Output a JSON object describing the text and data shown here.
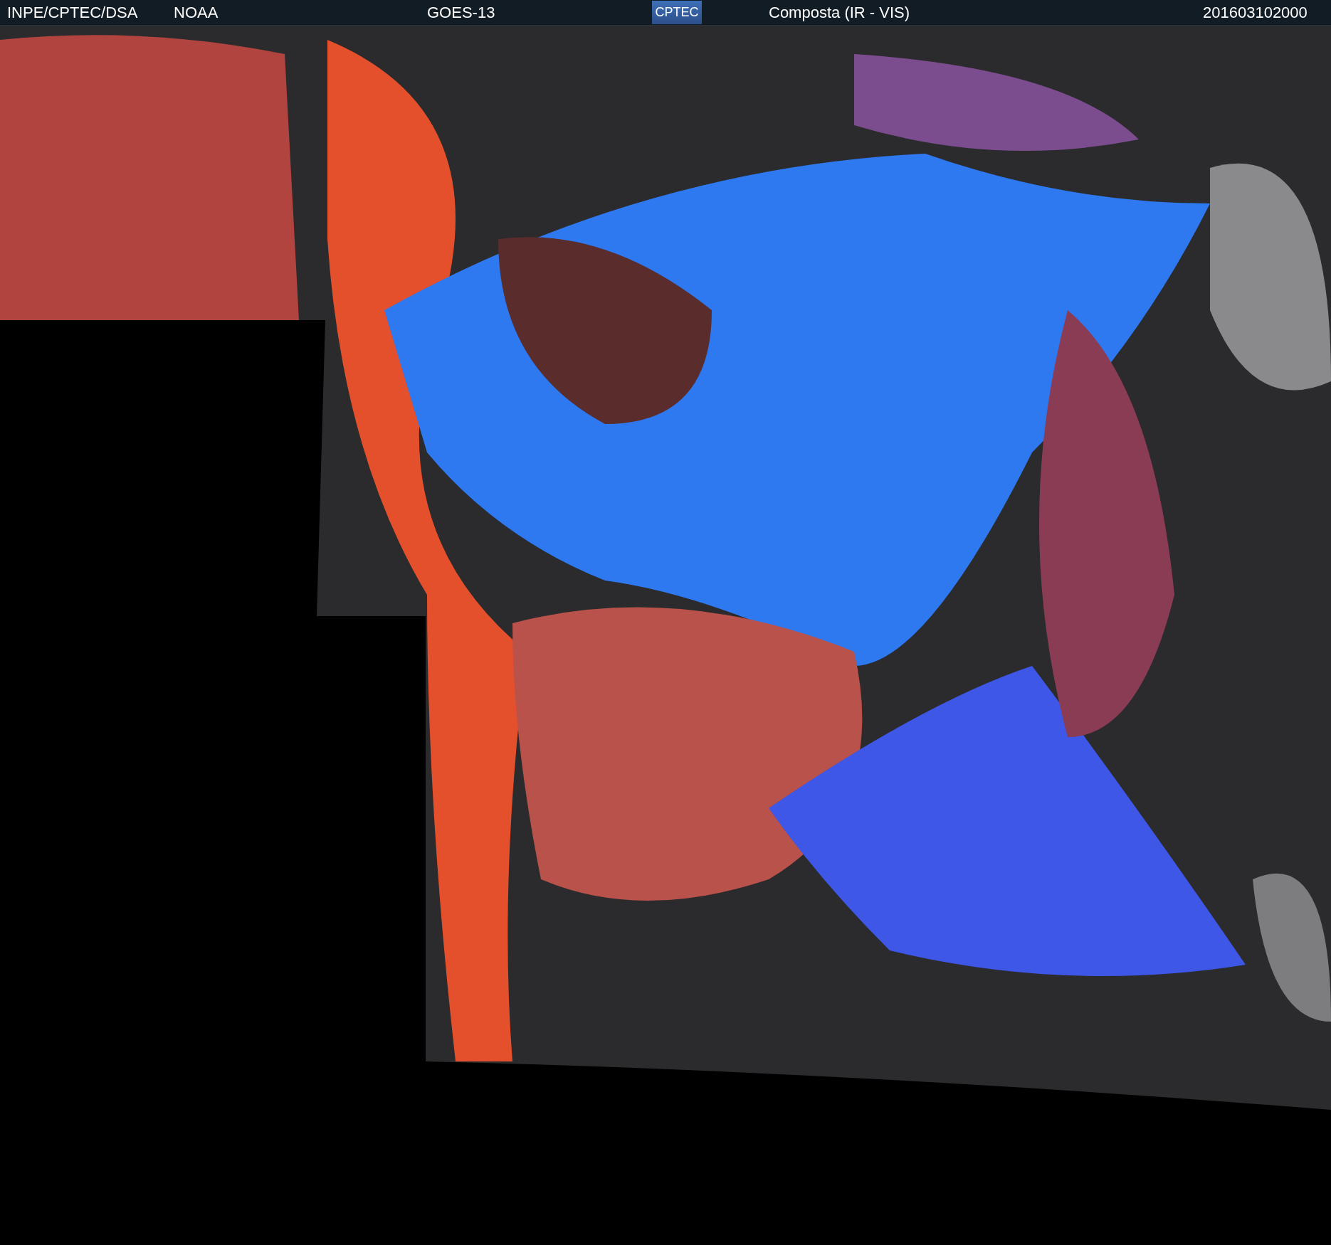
{
  "header": {
    "source": "INPE/CPTEC/DSA",
    "agency": "NOAA",
    "satellite": "GOES-13",
    "logo": "CPTEC",
    "product": "Composta (IR - VIS)",
    "timestamp": "201603102000"
  }
}
